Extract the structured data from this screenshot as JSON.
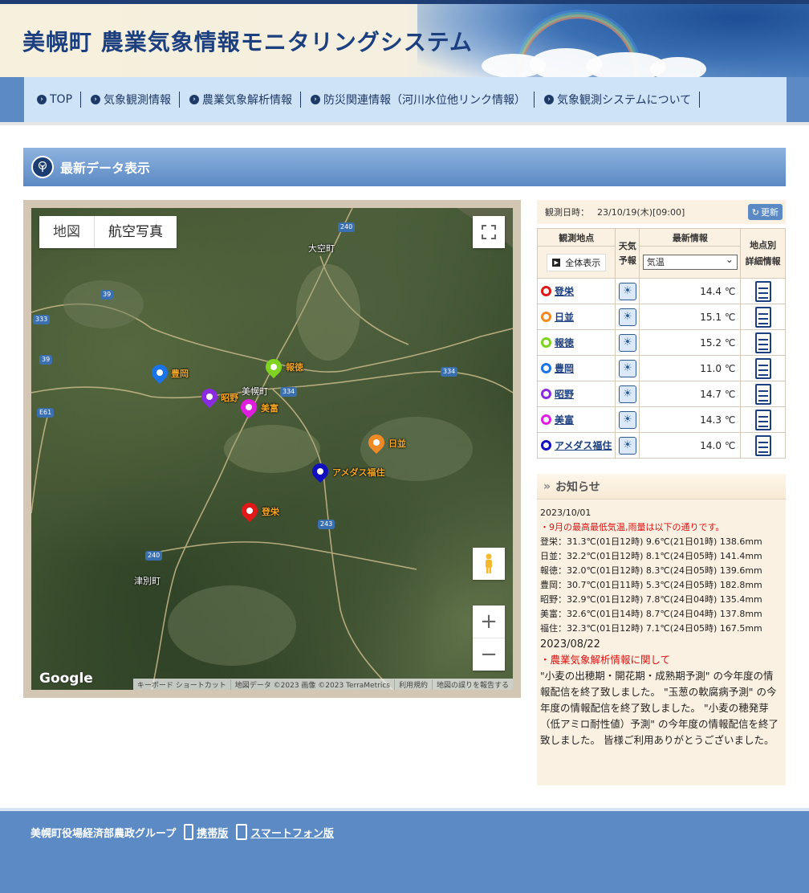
{
  "header": {
    "title": "美幌町 農業気象情報モニタリングシステム"
  },
  "nav": {
    "items": [
      {
        "label": "TOP"
      },
      {
        "label": "気象観測情報"
      },
      {
        "label": "農業気象解析情報"
      },
      {
        "label": "防災関連情報（河川水位他リンク情報）"
      },
      {
        "label": "気象観測システムについて"
      }
    ]
  },
  "section": {
    "title": "最新データ表示"
  },
  "map": {
    "type_buttons": [
      "地図",
      "航空写真"
    ],
    "google": "Google",
    "attribution": [
      "キーボード ショートカット",
      "地図データ ©2023 画像 ©2023 TerraMetrics",
      "利用規約",
      "地図の誤りを報告する"
    ],
    "places": [
      "大空町",
      "美幌町",
      "津別町"
    ],
    "road_numbers": [
      "240",
      "39",
      "333",
      "39",
      "E61",
      "334",
      "334",
      "243",
      "240"
    ],
    "markers": [
      {
        "label": "豊岡",
        "color": "#1a73e8"
      },
      {
        "label": "報徳",
        "color": "#7ed321"
      },
      {
        "label": "昭野",
        "color": "#8a2be2"
      },
      {
        "label": "美富",
        "color": "#e01ee0"
      },
      {
        "label": "日並",
        "color": "#f08a24"
      },
      {
        "label": "アメダス福住",
        "color": "#1010c0"
      },
      {
        "label": "登栄",
        "color": "#e01818"
      }
    ]
  },
  "obs": {
    "datetime_label": "観測日時：",
    "datetime": "23/10/19(木)[09:00]",
    "refresh": "更新",
    "headers": {
      "station": "観測地点",
      "forecast_1": "天気",
      "forecast_2": "予報",
      "latest": "最新情報",
      "detail_1": "地点別",
      "detail_2": "詳細情報"
    },
    "show_all": "全体表示",
    "select_value": "気温",
    "stations": [
      {
        "name": "登栄",
        "color": "#e01818",
        "value": "14.4 ℃"
      },
      {
        "name": "日並",
        "color": "#f08a24",
        "value": "15.1 ℃"
      },
      {
        "name": "報徳",
        "color": "#7ed321",
        "value": "15.2 ℃"
      },
      {
        "name": "豊岡",
        "color": "#1a73e8",
        "value": "11.0 ℃"
      },
      {
        "name": "昭野",
        "color": "#8a2be2",
        "value": "14.7 ℃"
      },
      {
        "name": "美富",
        "color": "#e01ee0",
        "value": "14.3 ℃"
      },
      {
        "name": "アメダス福住",
        "color": "#1010c0",
        "value": "14.0 ℃"
      }
    ]
  },
  "news": {
    "title": "お知らせ",
    "item1": {
      "date": "2023/10/01",
      "headline": "・9月の最高最低気温,雨量は以下の通りです。",
      "lines": [
        "登栄：31.3℃(01日12時) 9.6℃(21日01時) 138.6mm",
        "日並：32.2℃(01日12時) 8.1℃(24日05時) 141.4mm",
        "報徳：32.0℃(01日12時) 8.3℃(24日05時) 139.6mm",
        "豊岡：30.7℃(01日11時) 5.3℃(24日05時) 182.8mm",
        "昭野：32.9℃(01日12時) 7.8℃(24日04時) 135.4mm",
        "美富：32.6℃(01日14時) 8.7℃(24日04時) 137.8mm",
        "福住：32.3℃(01日12時) 7.1℃(24日05時) 167.5mm"
      ]
    },
    "item2": {
      "date": "2023/08/22",
      "headline": "・農業気象解析情報に関して",
      "text": "\"小麦の出穂期・開花期・成熟期予測\" の今年度の情報配信を終了致しました。 \"玉葱の軟腐病予測\" の今年度の情報配信を終了致しました。 \"小麦の穂発芽（低アミロ耐性値）予測\" の今年度の情報配信を終了致しました。 皆様ご利用ありがとうございました。"
    }
  },
  "footer": {
    "org": "美幌町役場経済部農政グループ",
    "mobile": "携帯版",
    "smartphone": "スマートフォン版"
  }
}
